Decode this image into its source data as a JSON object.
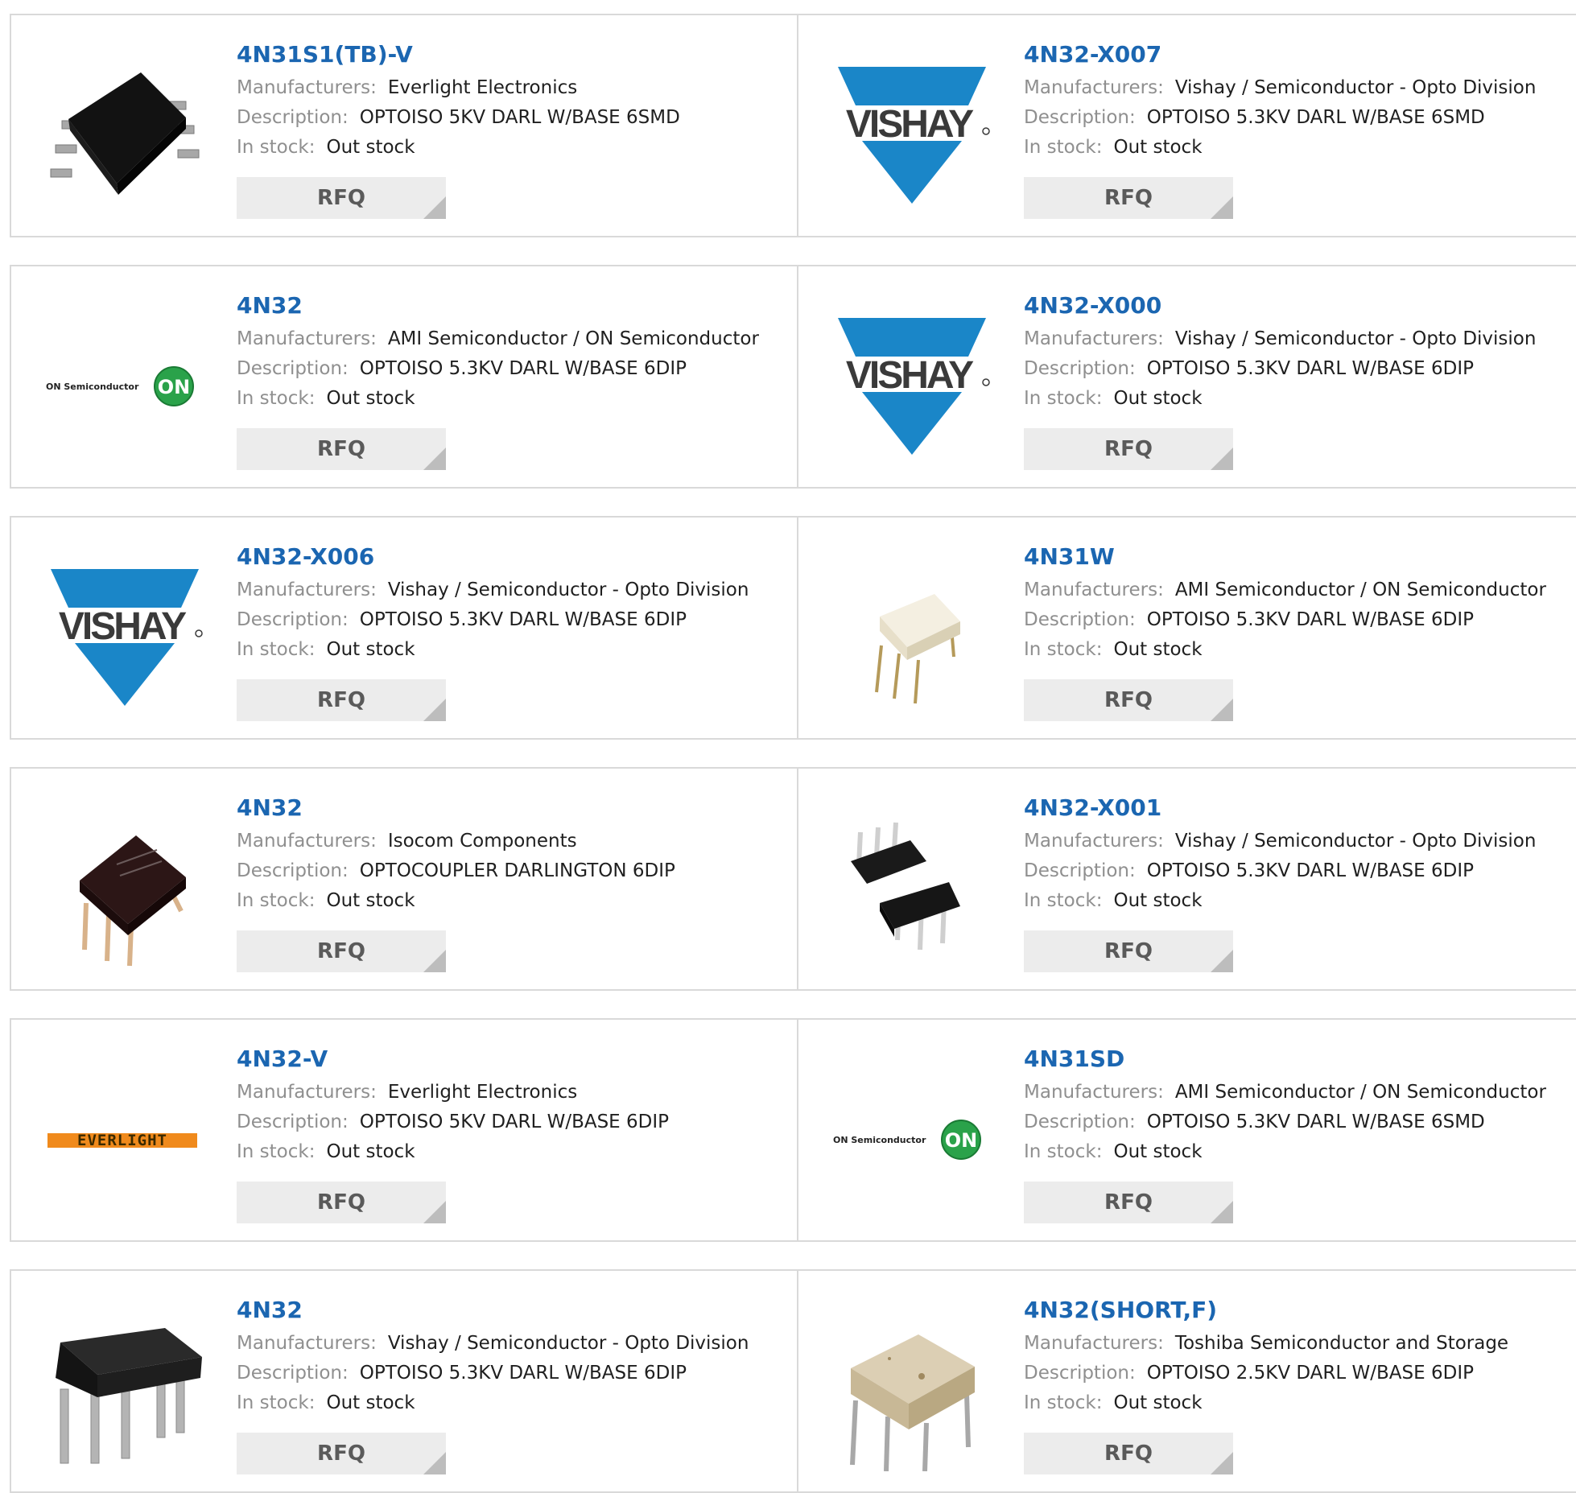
{
  "labels": {
    "manufacturers": "Manufacturers:",
    "description": "Description:",
    "stock": "In stock:",
    "rfq": "RFQ"
  },
  "theme": {
    "link_color": "#1b66b1",
    "label_color": "#8f8f8f",
    "border_color": "#d9d9d9",
    "button_bg": "#ececec",
    "vishay_blue": "#1a86c8",
    "on_green": "#2aa24a",
    "everlight_orange": "#f08a1c"
  },
  "products": [
    {
      "part": "4N31S1(TB)-V",
      "manufacturer": "Everlight Electronics",
      "description": "OPTOISO 5KV DARL W/BASE 6SMD",
      "stock": "Out stock",
      "image": "smd-chip-icon"
    },
    {
      "part": "4N32-X007",
      "manufacturer": "Vishay / Semiconductor - Opto Division",
      "description": "OPTOISO 5.3KV DARL W/BASE 6SMD",
      "stock": "Out stock",
      "image": "vishay-logo",
      "logo_text": "VISHAY"
    },
    {
      "part": "4N32",
      "manufacturer": "AMI Semiconductor / ON Semiconductor",
      "description": "OPTOISO 5.3KV DARL W/BASE 6DIP",
      "stock": "Out stock",
      "image": "on-semiconductor-logo",
      "logo_text": "ON Semiconductor",
      "logo_mark": "ON"
    },
    {
      "part": "4N32-X000",
      "manufacturer": "Vishay / Semiconductor - Opto Division",
      "description": "OPTOISO 5.3KV DARL W/BASE 6DIP",
      "stock": "Out stock",
      "image": "vishay-logo",
      "logo_text": "VISHAY"
    },
    {
      "part": "4N32-X006",
      "manufacturer": "Vishay / Semiconductor - Opto Division",
      "description": "OPTOISO 5.3KV DARL W/BASE 6DIP",
      "stock": "Out stock",
      "image": "vishay-logo",
      "logo_text": "VISHAY"
    },
    {
      "part": "4N31W",
      "manufacturer": "AMI Semiconductor / ON Semiconductor",
      "description": "OPTOISO 5.3KV DARL W/BASE 6DIP",
      "stock": "Out stock",
      "image": "white-dip-chip-icon"
    },
    {
      "part": "4N32",
      "manufacturer": "Isocom Components",
      "description": "OPTOCOUPLER DARLINGTON 6DIP",
      "stock": "Out stock",
      "image": "brown-dip-chip-icon"
    },
    {
      "part": "4N32-X001",
      "manufacturer": "Vishay / Semiconductor - Opto Division",
      "description": "OPTOISO 5.3KV DARL W/BASE 6DIP",
      "stock": "Out stock",
      "image": "dual-dip-chip-icon"
    },
    {
      "part": "4N32-V",
      "manufacturer": "Everlight Electronics",
      "description": "OPTOISO 5KV DARL W/BASE 6DIP",
      "stock": "Out stock",
      "image": "everlight-logo",
      "logo_text": "EVERLIGHT"
    },
    {
      "part": "4N31SD",
      "manufacturer": "AMI Semiconductor / ON Semiconductor",
      "description": "OPTOISO 5.3KV DARL W/BASE 6SMD",
      "stock": "Out stock",
      "image": "on-semiconductor-logo",
      "logo_text": "ON Semiconductor",
      "logo_mark": "ON"
    },
    {
      "part": "4N32",
      "manufacturer": "Vishay / Semiconductor - Opto Division",
      "description": "OPTOISO 5.3KV DARL W/BASE 6DIP",
      "stock": "Out stock",
      "image": "black-dip-chip-icon"
    },
    {
      "part": "4N32(SHORT,F)",
      "manufacturer": "Toshiba Semiconductor and Storage",
      "description": "OPTOISO 2.5KV DARL W/BASE 6DIP",
      "stock": "Out stock",
      "image": "beige-dip-chip-icon"
    }
  ]
}
